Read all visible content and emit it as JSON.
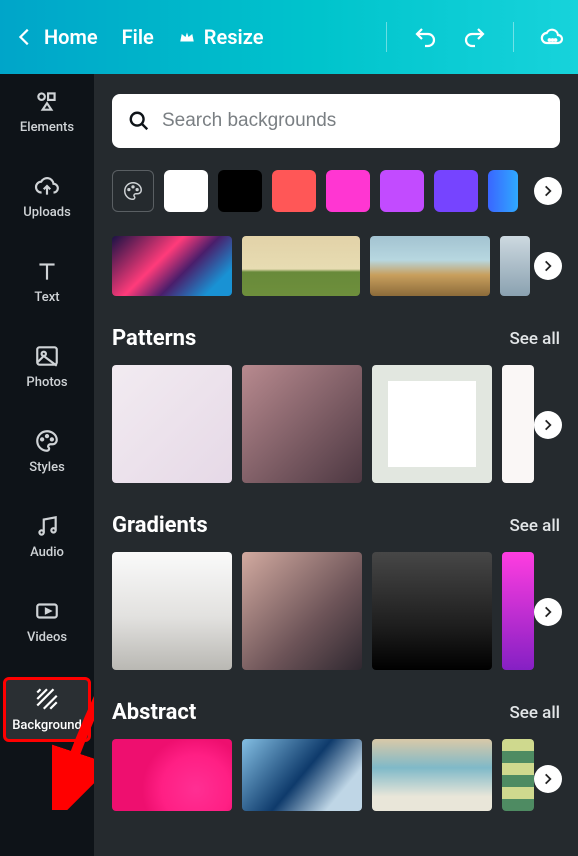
{
  "topbar": {
    "home": "Home",
    "file": "File",
    "resize": "Resize"
  },
  "sidebar": {
    "elements": "Elements",
    "uploads": "Uploads",
    "text": "Text",
    "photos": "Photos",
    "styles": "Styles",
    "audio": "Audio",
    "videos": "Videos",
    "background": "Background"
  },
  "search": {
    "placeholder": "Search backgrounds"
  },
  "colors": {
    "swatches": [
      "white",
      "black",
      "red",
      "pink",
      "purple",
      "indigo",
      "blue"
    ]
  },
  "sections": {
    "patterns": {
      "title": "Patterns",
      "see_all": "See all"
    },
    "gradients": {
      "title": "Gradients",
      "see_all": "See all"
    },
    "abstract": {
      "title": "Abstract",
      "see_all": "See all"
    }
  }
}
